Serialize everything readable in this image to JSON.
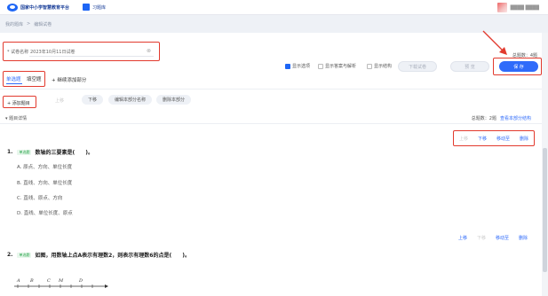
{
  "header": {
    "platform_name": "国家中小学智慧教育平台",
    "app_tab": "习题库",
    "user_name": "████ ████"
  },
  "breadcrumb": [
    "我的题库",
    ">",
    "编辑试卷"
  ],
  "exam": {
    "name_label": "* 试卷名称",
    "name_value": "2023年10月11日试卷",
    "total_score": "总题数：4题"
  },
  "options": {
    "show_options": "显示选项",
    "show_answer": "显示答案与解析",
    "show_structure": "显示结构",
    "download_button": "下载试卷",
    "preview_button": "预 览",
    "save_button": "保 存"
  },
  "tabs": {
    "items": [
      "单选题",
      "填空题"
    ],
    "add_part": "+ 继续添加部分"
  },
  "actions": {
    "add_question": "+ 添加题目",
    "move_up": "上移",
    "move_down": "下移",
    "edit_part_name": "编辑本部分名称",
    "delete_part": "删除本部分"
  },
  "list_head": {
    "left": "▾ 题目详情",
    "right_label": "总题数：",
    "right_count": "2题",
    "right_link": "查看本部分结构"
  },
  "questions": [
    {
      "number": "1.",
      "badge": "单选题",
      "text": "数轴的三要素是(　　)。",
      "actions": [
        "上移",
        "下移",
        "移动至",
        "删除"
      ],
      "options": [
        "A. 原点、方向、单位长度",
        "B. 直线、方向、单位长度",
        "C. 直线、原点、方向",
        "D. 直线、单位长度、原点"
      ]
    },
    {
      "number": "2.",
      "badge": "单选题",
      "text": "如图，用数轴上点A表示有理数2，则表示有理数6的点是(　　)。",
      "actions": [
        "上移",
        "下移",
        "移动至",
        "删除"
      ],
      "options": []
    }
  ],
  "number_line": {
    "labels": [
      "A",
      "B",
      "C",
      "M",
      "D"
    ]
  },
  "colors": {
    "primary": "#2f6bfa",
    "highlight": "#e23a2e",
    "badge_green": "#2ba54c"
  }
}
